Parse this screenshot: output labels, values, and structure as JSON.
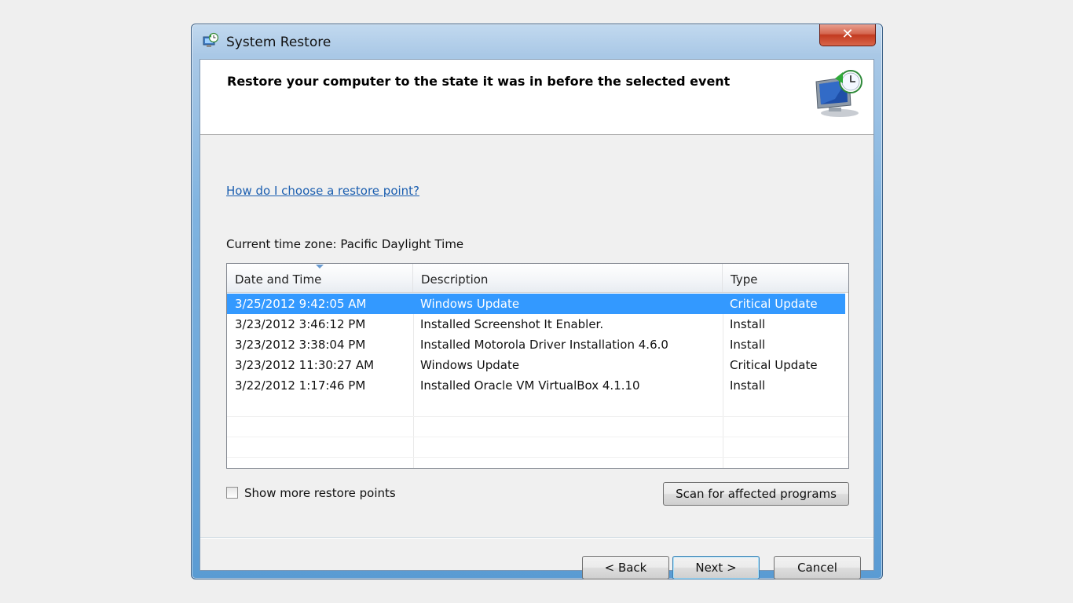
{
  "window": {
    "title": "System Restore",
    "close_label": "✕"
  },
  "header": {
    "title": "Restore your computer to the state it was in before the selected event"
  },
  "help_link": "How do I choose a restore point?",
  "timezone_label": "Current time zone: Pacific Daylight Time",
  "table": {
    "columns": [
      "Date and Time",
      "Description",
      "Type"
    ],
    "rows": [
      {
        "date": "3/25/2012 9:42:05 AM",
        "description": "Windows Update",
        "type": "Critical Update",
        "selected": true
      },
      {
        "date": "3/23/2012 3:46:12 PM",
        "description": "Installed Screenshot It Enabler.",
        "type": "Install",
        "selected": false
      },
      {
        "date": "3/23/2012 3:38:04 PM",
        "description": "Installed Motorola Driver Installation 4.6.0",
        "type": "Install",
        "selected": false
      },
      {
        "date": "3/23/2012 11:30:27 AM",
        "description": "Windows Update",
        "type": "Critical Update",
        "selected": false
      },
      {
        "date": "3/22/2012 1:17:46 PM",
        "description": "Installed Oracle VM VirtualBox 4.1.10",
        "type": "Install",
        "selected": false
      }
    ]
  },
  "show_more": {
    "label": "Show more restore points",
    "checked": false
  },
  "buttons": {
    "scan": "Scan for affected programs",
    "back": "< Back",
    "next": "Next >",
    "cancel": "Cancel"
  },
  "colors": {
    "selection": "#3399ff",
    "link": "#1c5fb0"
  },
  "icons": {
    "title": "system-restore-icon",
    "header": "computer-restore-clock-icon",
    "sort": "sort-ascending-icon"
  }
}
